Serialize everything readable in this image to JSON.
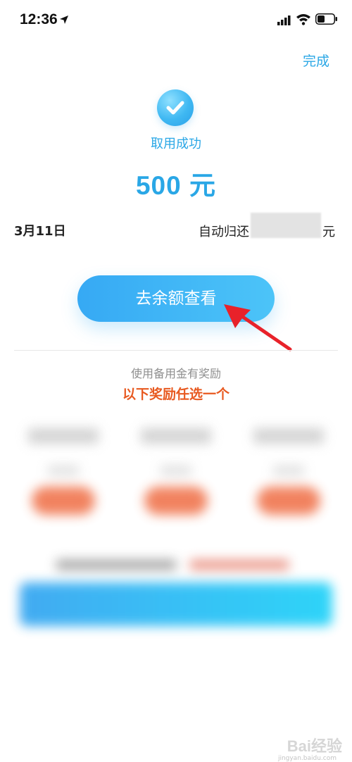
{
  "status_bar": {
    "time": "12:36"
  },
  "header": {
    "done_label": "完成"
  },
  "result": {
    "title": "取用成功",
    "amount": "500 元"
  },
  "repayment": {
    "date": "3月11日",
    "label": "自动归还",
    "unit": "元"
  },
  "actions": {
    "check_balance_label": "去余额查看"
  },
  "rewards": {
    "caption": "使用备用金有奖励",
    "subtitle": "以下奖励任选一个"
  },
  "watermark": {
    "text": "Bai经验",
    "url": "jingyan.baidu.com"
  },
  "colors": {
    "accent": "#2aa7e6",
    "reward_highlight": "#e85a21",
    "annotation_arrow": "#e8222a"
  },
  "icons": [
    "location-arrow-icon",
    "signal-icon",
    "wifi-icon",
    "battery-icon",
    "check-circle-icon"
  ]
}
